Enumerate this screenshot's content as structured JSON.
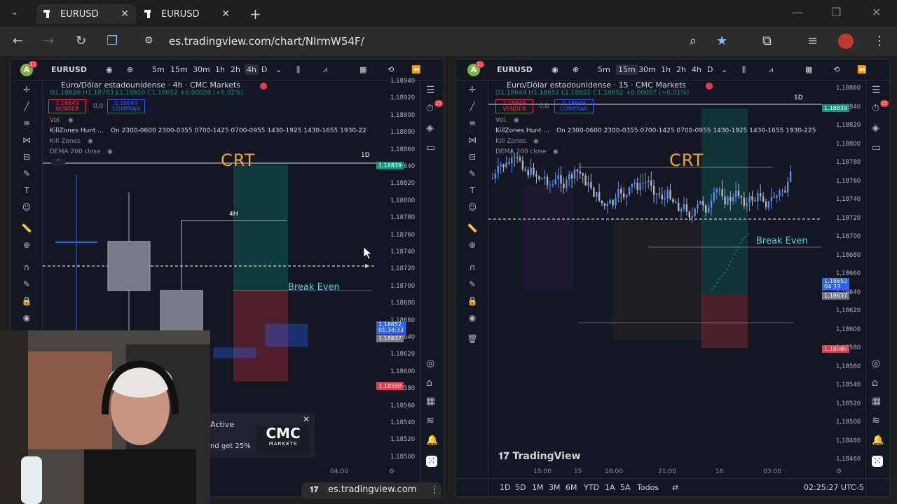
{
  "browser": {
    "tabs": [
      {
        "label": "EURUSD"
      },
      {
        "label": "EURUSD"
      }
    ],
    "url": "es.tradingview.com/chart/NIrmW54F/",
    "status_url": "es.tradingview.com"
  },
  "left_pane": {
    "symbol": "EURUSD",
    "avatar": "A",
    "notif": "11",
    "intervals": [
      "5m",
      "15m",
      "30m",
      "1h",
      "2h",
      "4h",
      "D"
    ],
    "active_interval": "4h",
    "title": "Euro/Dólar estadounidense · 4h · CMC Markets",
    "ohlc": "O1,18626 H1,18703 L1,18610 C1,18652 +0,00028 (+0,02%)",
    "sell_price": "1,18649",
    "sell_label": "VENDER",
    "spread": "0,0",
    "buy_price": "1,18649",
    "buy_label": "COMPRAR",
    "ind_vol": "Vol.",
    "ind_kz": "KillZones Hunt ...",
    "ind_kz_vals": "On 2300-0600 2300-0355 0700-1425 0700-0955 1430-1925 1430-1655 1930-22",
    "ind_killzones": "Kill Zones",
    "ind_dema": "DEMA 200 close",
    "crt": "CRT",
    "break_even": "Break Even",
    "label_1d": "1D",
    "label_4h": "4H",
    "price_labels": [
      "1,18940",
      "1,18920",
      "1,18900",
      "1,18880",
      "1,18860",
      "1,18840",
      "1,18820",
      "1,18800",
      "1,18780",
      "1,18760",
      "1,18740",
      "1,18720",
      "1,18700",
      "1,18680",
      "1,18660",
      "1,18640",
      "1,18620",
      "1,18600",
      "1,18580",
      "1,18560",
      "1,18540",
      "1,18520",
      "1,18500"
    ],
    "tag_green": "1,18839",
    "tag_blue": "1,18652",
    "tag_blue_time": "01:34:33",
    "tag_gray": "1,18637",
    "tag_red": "1,18580",
    "time_label": "04:00",
    "alert_count": "15"
  },
  "right_pane": {
    "symbol": "EURUSD",
    "avatar": "A",
    "notif": "11",
    "intervals": [
      "5m",
      "15m",
      "30m",
      "1h",
      "2h",
      "4h",
      "D"
    ],
    "active_interval": "15m",
    "title": "Euro/Dólar estadounidense · 15 · CMC Markets",
    "ohlc": "O1,18644 H1,18652 L1,18622 C1,18652 +0,00007 (+0,01%)",
    "sell_price": "1,18649",
    "sell_label": "VENDER",
    "spread": "0,0",
    "buy_price": "1,18649",
    "buy_label": "COMPRAR",
    "ind_vol": "Vol.",
    "ind_kz": "KillZones Hunt ...",
    "ind_kz_vals": "On 2300-0600 2300-0355 0700-1425 0700-0955 1430-1925 1430-1655 1930-225",
    "ind_killzones": "Kill Zones",
    "ind_dema": "DEMA 200 close",
    "crt": "CRT",
    "break_even": "Break Even",
    "label_1d": "1D",
    "price_labels": [
      "1,18860",
      "1,18840",
      "1,18820",
      "1,18800",
      "1,18780",
      "1,18760",
      "1,18740",
      "1,18720",
      "1,18700",
      "1,18680",
      "1,18660",
      "1,18640",
      "1,18620",
      "1,18600",
      "1,18580",
      "1,18560",
      "1,18540",
      "1,18520",
      "1,18500",
      "1,18480",
      "1,18460"
    ],
    "tag_green": "1,18839",
    "tag_blue": "1,18652",
    "tag_blue_time": "04:33",
    "tag_gray": "1,18637",
    "tag_red": "1,18580",
    "time_labels": [
      "15:00",
      "15",
      "18:00",
      "21:00",
      "16",
      "03:00"
    ],
    "watermark": "TradingView",
    "ranges": [
      "1D",
      "5D",
      "1M",
      "3M",
      "6M",
      "YTD",
      "1A",
      "5A",
      "Todos"
    ],
    "clock": "02:25:27 UTC-5",
    "alert_count": "15"
  },
  "popup": {
    "active": "Active",
    "promo": "nd get 25%",
    "brand_line1": "CMC",
    "brand_line2": "MARKETS"
  },
  "colors": {
    "bg": "#131722",
    "green": "#089981",
    "red": "#f23645",
    "blue": "#2962ff",
    "orange": "#f5a623",
    "cyan": "#4dd0e1"
  }
}
